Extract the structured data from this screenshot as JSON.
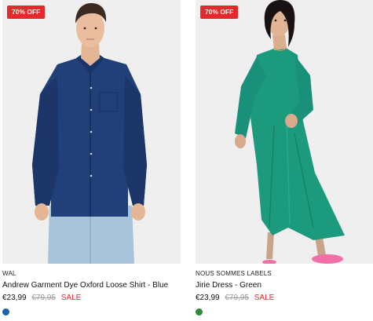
{
  "products": [
    {
      "badge": "70% OFF",
      "brand": "WAL",
      "title": "Andrew Garment Dye Oxford Loose Shirt - Blue",
      "price_current": "€23,99",
      "price_original": "€79,95",
      "sale_label": "SALE",
      "swatch_color": "#1f62a8",
      "image_icon": "model-blue-oxford-shirt-image"
    },
    {
      "badge": "70% OFF",
      "brand": "NOUS SOMMES LABELS",
      "title": "Jirie Dress - Green",
      "price_current": "€23,99",
      "price_original": "€79,95",
      "sale_label": "SALE",
      "swatch_color": "#2e8b3a",
      "image_icon": "model-green-dress-image"
    }
  ],
  "colors": {
    "badge_bg": "#e3292b",
    "sale_text": "#e3292b",
    "image_bg": "#efefef"
  }
}
